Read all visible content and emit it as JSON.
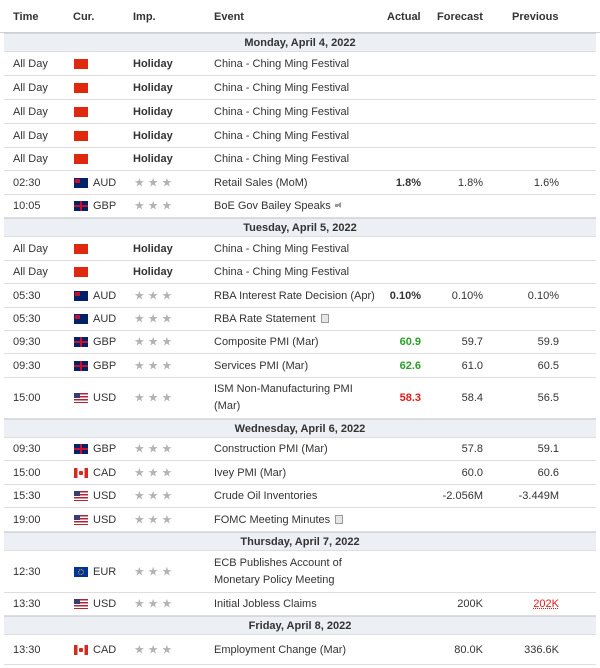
{
  "headers": {
    "time": "Time",
    "cur": "Cur.",
    "imp": "Imp.",
    "event": "Event",
    "actual": "Actual",
    "forecast": "Forecast",
    "previous": "Previous"
  },
  "colors": {
    "positive": "#2aa12a",
    "negative": "#e21a1a",
    "date_row_bg": "#eceff3",
    "star": "#b3b3b3"
  },
  "rows": [
    {
      "type": "date",
      "label": "Monday, April 4, 2022"
    },
    {
      "type": "event",
      "time": "All Day",
      "flag": "cny",
      "cur": "",
      "holiday": "Holiday",
      "event": "China - Ching Ming Festival"
    },
    {
      "type": "event",
      "time": "All Day",
      "flag": "cny",
      "cur": "",
      "holiday": "Holiday",
      "event": "China - Ching Ming Festival"
    },
    {
      "type": "event",
      "time": "All Day",
      "flag": "cny",
      "cur": "",
      "holiday": "Holiday",
      "event": "China - Ching Ming Festival"
    },
    {
      "type": "event",
      "time": "All Day",
      "flag": "cny",
      "cur": "",
      "holiday": "Holiday",
      "event": "China - Ching Ming Festival"
    },
    {
      "type": "event",
      "time": "All Day",
      "flag": "cny",
      "cur": "",
      "holiday": "Holiday",
      "event": "China - Ching Ming Festival"
    },
    {
      "type": "event",
      "time": "02:30",
      "flag": "aud",
      "cur": "AUD",
      "stars": 3,
      "event": "Retail Sales (MoM)",
      "actual": "1.8%",
      "forecast": "1.8%",
      "previous": "1.6%"
    },
    {
      "type": "event",
      "time": "10:05",
      "flag": "gbp",
      "cur": "GBP",
      "stars": 3,
      "event": "BoE Gov Bailey Speaks",
      "icon": "speaker-icon"
    },
    {
      "type": "date",
      "label": "Tuesday, April 5, 2022"
    },
    {
      "type": "event",
      "time": "All Day",
      "flag": "cny",
      "cur": "",
      "holiday": "Holiday",
      "event": "China - Ching Ming Festival"
    },
    {
      "type": "event",
      "time": "All Day",
      "flag": "cny",
      "cur": "",
      "holiday": "Holiday",
      "event": "China - Ching Ming Festival"
    },
    {
      "type": "event",
      "time": "05:30",
      "flag": "aud",
      "cur": "AUD",
      "stars": 3,
      "event": "RBA Interest Rate Decision (Apr)",
      "actual": "0.10%",
      "forecast": "0.10%",
      "previous": "0.10%"
    },
    {
      "type": "event",
      "time": "05:30",
      "flag": "aud",
      "cur": "AUD",
      "stars": 3,
      "event": "RBA Rate Statement",
      "icon": "document-icon"
    },
    {
      "type": "event",
      "time": "09:30",
      "flag": "gbp",
      "cur": "GBP",
      "stars": 3,
      "event": "Composite PMI (Mar)",
      "actual": "60.9",
      "actual_color": "positive",
      "forecast": "59.7",
      "previous": "59.9"
    },
    {
      "type": "event",
      "time": "09:30",
      "flag": "gbp",
      "cur": "GBP",
      "stars": 3,
      "event": "Services PMI (Mar)",
      "actual": "62.6",
      "actual_color": "positive",
      "forecast": "61.0",
      "previous": "60.5"
    },
    {
      "type": "event",
      "time": "15:00",
      "flag": "usd",
      "cur": "USD",
      "stars": 3,
      "event": "ISM Non-Manufacturing PMI (Mar)",
      "two_line": true,
      "actual": "58.3",
      "actual_color": "negative",
      "forecast": "58.4",
      "previous": "56.5"
    },
    {
      "type": "date",
      "label": "Wednesday, April 6, 2022"
    },
    {
      "type": "event",
      "time": "09:30",
      "flag": "gbp",
      "cur": "GBP",
      "stars": 3,
      "event": "Construction PMI (Mar)",
      "forecast": "57.8",
      "previous": "59.1"
    },
    {
      "type": "event",
      "time": "15:00",
      "flag": "cad",
      "cur": "CAD",
      "stars": 3,
      "event": "Ivey PMI (Mar)",
      "forecast": "60.0",
      "previous": "60.6"
    },
    {
      "type": "event",
      "time": "15:30",
      "flag": "usd",
      "cur": "USD",
      "stars": 3,
      "event": "Crude Oil Inventories",
      "forecast": "-2.056M",
      "previous": "-3.449M"
    },
    {
      "type": "event",
      "time": "19:00",
      "flag": "usd",
      "cur": "USD",
      "stars": 3,
      "event": "FOMC Meeting Minutes",
      "icon": "document-icon"
    },
    {
      "type": "date",
      "label": "Thursday, April 7, 2022"
    },
    {
      "type": "event",
      "time": "12:30",
      "flag": "eur",
      "cur": "EUR",
      "stars": 3,
      "event": "ECB Publishes Account of Monetary Policy Meeting",
      "two_line": true
    },
    {
      "type": "event",
      "time": "13:30",
      "flag": "usd",
      "cur": "USD",
      "stars": 3,
      "event": "Initial Jobless Claims",
      "forecast": "200K",
      "previous": "202K",
      "previous_revised": true
    },
    {
      "type": "date",
      "label": "Friday, April 8, 2022"
    },
    {
      "type": "event",
      "time": "13:30",
      "flag": "cad",
      "cur": "CAD",
      "stars": 3,
      "event": "Employment Change (Mar)",
      "forecast": "80.0K",
      "previous": "336.6K"
    }
  ]
}
